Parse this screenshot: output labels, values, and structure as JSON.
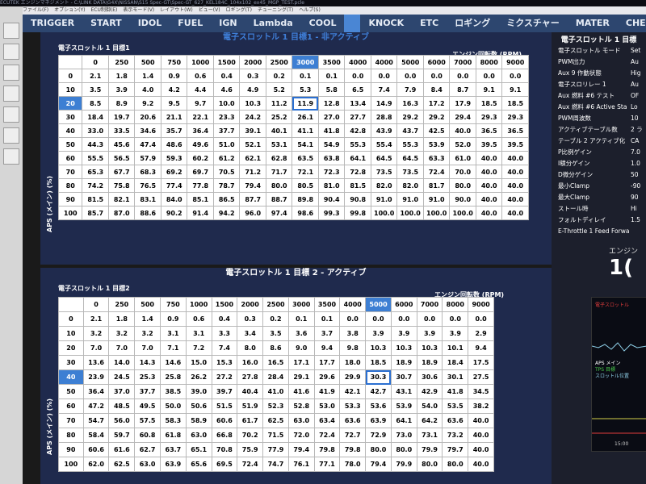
{
  "window_title": "ECUTEK エンジンマネジメント - C:\\LINK DATA\\G4X\\NISSAN\\S15 Spec-GT\\Spec-GT_627_KEL184C_104x102_ex45_MGP_TEST.pcle",
  "menu": [
    "ファイル(F)",
    "オプション(Y)",
    "ECU制御(E)",
    "表示モード(V)",
    "レイアウト(W)",
    "ビュー(V)",
    "ロギング(T)",
    "チューニング(T)",
    "ヘルプ(S)"
  ],
  "tabs": [
    "TRIGGER",
    "START",
    "IDOL",
    "FUEL",
    "IGN",
    "Lambda",
    "COOL",
    "",
    "KNOCK",
    "ETC",
    "ロギング",
    "ミクスチャー",
    "MATER",
    "CHECK"
  ],
  "active_tab_index": 7,
  "top_panel": {
    "title": "電子スロットル 1 目標1 - 非アクティブ",
    "subtitle": "電子スロットル 1 目標1",
    "axis_label": "エンジン回転数 (RPM)",
    "y_label": "APS (メイン) (%)",
    "rpm": [
      "0",
      "250",
      "500",
      "750",
      "1000",
      "1500",
      "2000",
      "2500",
      "3000",
      "3500",
      "4000",
      "4000",
      "5000",
      "6000",
      "7000",
      "8000",
      "9000"
    ],
    "aps": [
      "0",
      "10",
      "20",
      "30",
      "40",
      "50",
      "60",
      "70",
      "80",
      "90",
      "100"
    ],
    "selected_col": 8,
    "selected_row": 2,
    "rows": [
      [
        "2.1",
        "1.8",
        "1.4",
        "0.9",
        "0.6",
        "0.4",
        "0.3",
        "0.2",
        "0.1",
        "0.1",
        "0.0",
        "0.0",
        "0.0",
        "0.0",
        "0.0",
        "0.0",
        "0.0"
      ],
      [
        "3.5",
        "3.9",
        "4.0",
        "4.2",
        "4.4",
        "4.6",
        "4.9",
        "5.2",
        "5.3",
        "5.8",
        "6.5",
        "7.4",
        "7.9",
        "8.4",
        "8.7",
        "9.1",
        "9.1"
      ],
      [
        "8.5",
        "8.9",
        "9.2",
        "9.5",
        "9.7",
        "10.0",
        "10.3",
        "11.2",
        "11.9",
        "12.8",
        "13.4",
        "14.9",
        "16.3",
        "17.2",
        "17.9",
        "18.5",
        "18.5"
      ],
      [
        "18.4",
        "19.7",
        "20.6",
        "21.1",
        "22.1",
        "23.3",
        "24.2",
        "25.2",
        "26.1",
        "27.0",
        "27.7",
        "28.8",
        "29.2",
        "29.2",
        "29.4",
        "29.3",
        "29.3"
      ],
      [
        "33.0",
        "33.5",
        "34.6",
        "35.7",
        "36.4",
        "37.7",
        "39.1",
        "40.1",
        "41.1",
        "41.8",
        "42.8",
        "43.9",
        "43.7",
        "42.5",
        "40.0",
        "36.5",
        "36.5"
      ],
      [
        "44.3",
        "45.6",
        "47.4",
        "48.6",
        "49.6",
        "51.0",
        "52.1",
        "53.1",
        "54.1",
        "54.9",
        "55.3",
        "55.4",
        "55.3",
        "53.9",
        "52.0",
        "39.5",
        "39.5"
      ],
      [
        "55.5",
        "56.5",
        "57.9",
        "59.3",
        "60.2",
        "61.2",
        "62.1",
        "62.8",
        "63.5",
        "63.8",
        "64.1",
        "64.5",
        "64.5",
        "63.3",
        "61.0",
        "40.0",
        "40.0"
      ],
      [
        "65.3",
        "67.7",
        "68.3",
        "69.2",
        "69.7",
        "70.5",
        "71.2",
        "71.7",
        "72.1",
        "72.3",
        "72.8",
        "73.5",
        "73.5",
        "72.4",
        "70.0",
        "40.0",
        "40.0"
      ],
      [
        "74.2",
        "75.8",
        "76.5",
        "77.4",
        "77.8",
        "78.7",
        "79.4",
        "80.0",
        "80.5",
        "81.0",
        "81.5",
        "82.0",
        "82.0",
        "81.7",
        "80.0",
        "40.0",
        "40.0"
      ],
      [
        "81.5",
        "82.1",
        "83.1",
        "84.0",
        "85.1",
        "86.5",
        "87.7",
        "88.7",
        "89.8",
        "90.4",
        "90.8",
        "91.0",
        "91.0",
        "91.0",
        "90.0",
        "40.0",
        "40.0"
      ],
      [
        "85.7",
        "87.0",
        "88.6",
        "90.2",
        "91.4",
        "94.2",
        "96.0",
        "97.4",
        "98.6",
        "99.3",
        "99.8",
        "100.0",
        "100.0",
        "100.0",
        "100.0",
        "40.0",
        "40.0"
      ]
    ]
  },
  "bottom_panel": {
    "title": "電子スロットル 1 目標 2 - アクティブ",
    "subtitle": "電子スロットル 1 目標2",
    "axis_label": "エンジン回転数 (RPM)",
    "y_label": "APS (メイン) (%)",
    "rpm": [
      "0",
      "250",
      "500",
      "750",
      "1000",
      "1500",
      "2000",
      "2500",
      "3000",
      "3500",
      "4000",
      "5000",
      "6000",
      "7000",
      "8000",
      "9000"
    ],
    "aps": [
      "0",
      "10",
      "20",
      "30",
      "40",
      "50",
      "60",
      "70",
      "80",
      "90",
      "100"
    ],
    "selected_col": 11,
    "selected_row": 4,
    "rows": [
      [
        "2.1",
        "1.8",
        "1.4",
        "0.9",
        "0.6",
        "0.4",
        "0.3",
        "0.2",
        "0.1",
        "0.1",
        "0.0",
        "0.0",
        "0.0",
        "0.0",
        "0.0",
        "0.0"
      ],
      [
        "3.2",
        "3.2",
        "3.2",
        "3.1",
        "3.1",
        "3.3",
        "3.4",
        "3.5",
        "3.6",
        "3.7",
        "3.8",
        "3.9",
        "3.9",
        "3.9",
        "3.9",
        "2.9"
      ],
      [
        "7.0",
        "7.0",
        "7.0",
        "7.1",
        "7.2",
        "7.4",
        "8.0",
        "8.6",
        "9.0",
        "9.4",
        "9.8",
        "10.3",
        "10.3",
        "10.3",
        "10.1",
        "9.4"
      ],
      [
        "13.6",
        "14.0",
        "14.3",
        "14.6",
        "15.0",
        "15.3",
        "16.0",
        "16.5",
        "17.1",
        "17.7",
        "18.0",
        "18.5",
        "18.9",
        "18.9",
        "18.4",
        "17.5"
      ],
      [
        "23.9",
        "24.5",
        "25.3",
        "25.8",
        "26.2",
        "27.2",
        "27.8",
        "28.4",
        "29.1",
        "29.6",
        "29.9",
        "30.3",
        "30.7",
        "30.6",
        "30.1",
        "27.5"
      ],
      [
        "36.4",
        "37.0",
        "37.7",
        "38.5",
        "39.0",
        "39.7",
        "40.4",
        "41.0",
        "41.6",
        "41.9",
        "42.1",
        "42.7",
        "43.1",
        "42.9",
        "41.8",
        "34.5"
      ],
      [
        "47.2",
        "48.5",
        "49.5",
        "50.0",
        "50.6",
        "51.5",
        "51.9",
        "52.3",
        "52.8",
        "53.0",
        "53.3",
        "53.6",
        "53.9",
        "54.0",
        "53.5",
        "38.2"
      ],
      [
        "54.7",
        "56.0",
        "57.5",
        "58.3",
        "58.9",
        "60.6",
        "61.7",
        "62.5",
        "63.0",
        "63.4",
        "63.6",
        "63.9",
        "64.1",
        "64.2",
        "63.6",
        "40.0"
      ],
      [
        "58.4",
        "59.7",
        "60.8",
        "61.8",
        "63.0",
        "66.8",
        "70.2",
        "71.5",
        "72.0",
        "72.4",
        "72.7",
        "72.9",
        "73.0",
        "73.1",
        "73.2",
        "40.0"
      ],
      [
        "60.6",
        "61.6",
        "62.7",
        "63.7",
        "65.1",
        "70.8",
        "75.9",
        "77.9",
        "79.4",
        "79.8",
        "79.8",
        "80.0",
        "80.0",
        "79.9",
        "79.7",
        "40.0"
      ],
      [
        "62.0",
        "62.5",
        "63.0",
        "63.9",
        "65.6",
        "69.5",
        "72.4",
        "74.7",
        "76.1",
        "77.1",
        "78.0",
        "79.4",
        "79.9",
        "80.0",
        "80.0",
        "40.0"
      ]
    ]
  },
  "right_panel": {
    "title": "電子スロットル 1 目標",
    "params": [
      {
        "name": "電子スロットル モード",
        "value": "Set"
      },
      {
        "name": "PWM出力",
        "value": "Au"
      },
      {
        "name": "Aux 9 作動状態",
        "value": "Hig"
      },
      {
        "name": "電子スロリレー 1",
        "value": "Au"
      },
      {
        "name": "Aux 燃料 #6 テスト",
        "value": "OF"
      },
      {
        "name": "Aux 燃料 #6 Active Sta",
        "value": "Lo"
      },
      {
        "name": "PWM周波数",
        "value": "10"
      },
      {
        "name": "アクティブテーブル数",
        "value": "2 ラ"
      },
      {
        "name": "テーブル 2 アクティブ化",
        "value": "CA"
      },
      {
        "name": "P比例ゲイン",
        "value": "7.0"
      },
      {
        "name": "I積分ゲイン",
        "value": "1.0"
      },
      {
        "name": "D微分ゲイン",
        "value": "50"
      },
      {
        "name": "最小Clamp",
        "value": "-90"
      },
      {
        "name": "最大Clamp",
        "value": "90"
      },
      {
        "name": "ストール時",
        "value": "Hi"
      },
      {
        "name": "フォルトディレイ",
        "value": "1.5"
      },
      {
        "name": "E-Throttle 1 Feed Forwa",
        "value": ""
      }
    ],
    "engine_label": "エンジン",
    "engine_value": "1(",
    "chart_labels": [
      "電子スロットル",
      "APS メイン",
      "TPS 目標",
      "スロットル位置"
    ],
    "chart_time": "15:00"
  }
}
